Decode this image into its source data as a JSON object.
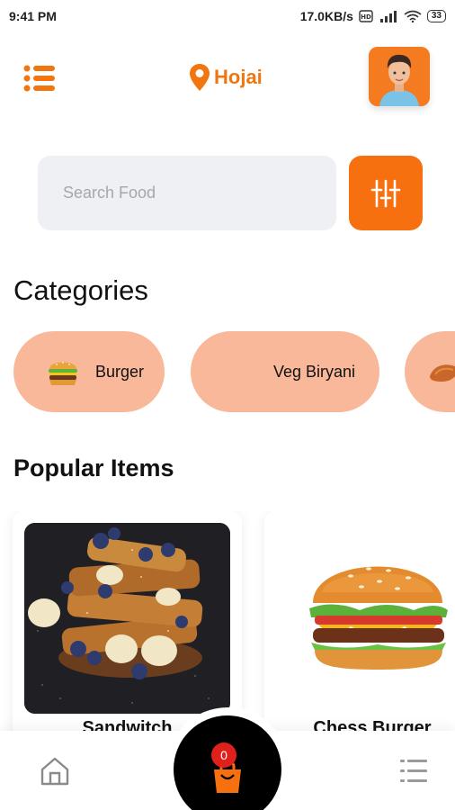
{
  "status_bar": {
    "time": "9:41 PM",
    "network_speed": "17.0KB/s",
    "battery": "33"
  },
  "header": {
    "location": "Hojai",
    "menu_icon": "hamburger-menu-icon",
    "location_icon": "map-pin-icon",
    "avatar": "user-avatar"
  },
  "search": {
    "placeholder": "Search Food",
    "filter_icon": "sliders-icon"
  },
  "categories": {
    "title": "Categories",
    "items": [
      {
        "label": "Burger",
        "icon": "burger-emoji"
      },
      {
        "label": "Veg Biryani",
        "icon": ""
      },
      {
        "label": "",
        "icon": "fried-chicken-image"
      }
    ]
  },
  "popular": {
    "title": "Popular Items",
    "items": [
      {
        "name": "Sandwitch",
        "image": "french-toast-blueberries-banana"
      },
      {
        "name": "Chess Burger",
        "image": "cheeseburger"
      }
    ]
  },
  "bottom_nav": {
    "home_icon": "home-icon",
    "list_icon": "list-icon",
    "cart_icon": "shopping-bag-icon",
    "cart_count": "0"
  },
  "colors": {
    "accent": "#f7700f",
    "chip": "#f9b89a",
    "search_bg": "#eef0f3",
    "badge": "#e0201b"
  }
}
